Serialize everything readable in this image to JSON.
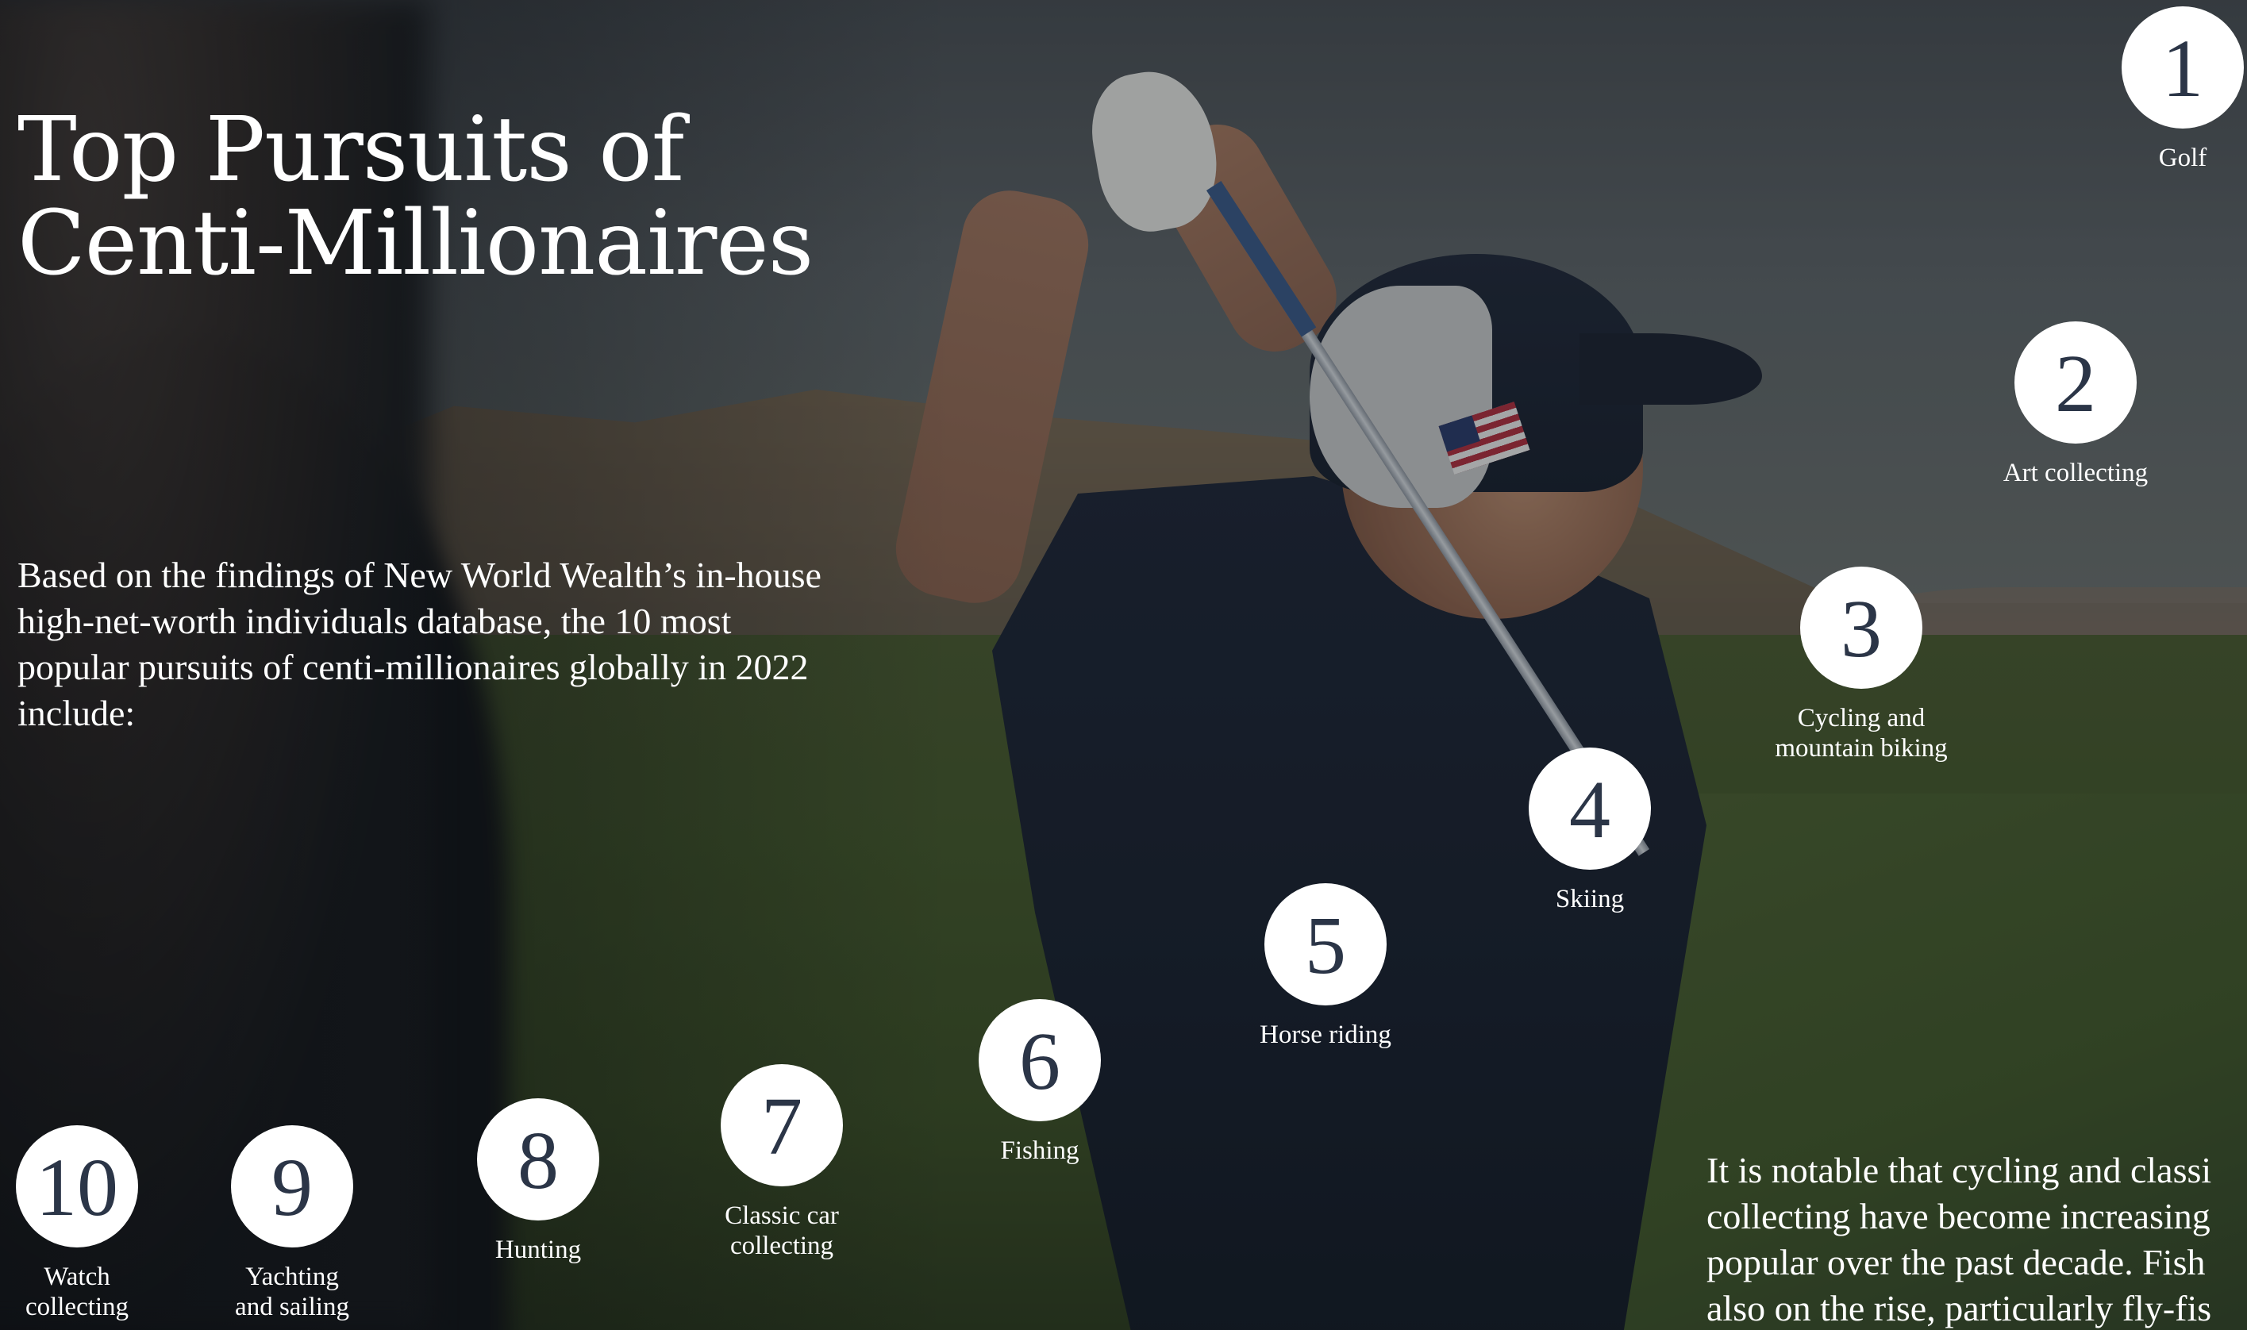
{
  "title_line1": "Top Pursuits of",
  "title_line2": "Centi-Millionaires",
  "intro": "Based on the findings of New World Wealth’s in-house high-net-worth individuals database, the 10 most popular pursuits of centi-millionaires globally in 2022 include:",
  "note_lines": [
    "It is notable that cycling and classi",
    "collecting have become increasing",
    "popular over the past decade. Fish",
    "also on the rise, particularly fly-fis"
  ],
  "pursuits": [
    {
      "rank": "1",
      "label_line1": "Golf",
      "label_line2": ""
    },
    {
      "rank": "2",
      "label_line1": "Art collecting",
      "label_line2": ""
    },
    {
      "rank": "3",
      "label_line1": "Cycling and",
      "label_line2": "mountain biking"
    },
    {
      "rank": "4",
      "label_line1": "Skiing",
      "label_line2": ""
    },
    {
      "rank": "5",
      "label_line1": "Horse riding",
      "label_line2": ""
    },
    {
      "rank": "6",
      "label_line1": "Fishing",
      "label_line2": ""
    },
    {
      "rank": "7",
      "label_line1": "Classic car",
      "label_line2": "collecting"
    },
    {
      "rank": "8",
      "label_line1": "Hunting",
      "label_line2": ""
    },
    {
      "rank": "9",
      "label_line1": "Yachting",
      "label_line2": "and sailing"
    },
    {
      "rank": "10",
      "label_line1": "Watch",
      "label_line2": "collecting"
    }
  ],
  "colors": {
    "circle_fill": "#ffffff",
    "circle_number": "#2b3547",
    "text": "#ffffff"
  }
}
